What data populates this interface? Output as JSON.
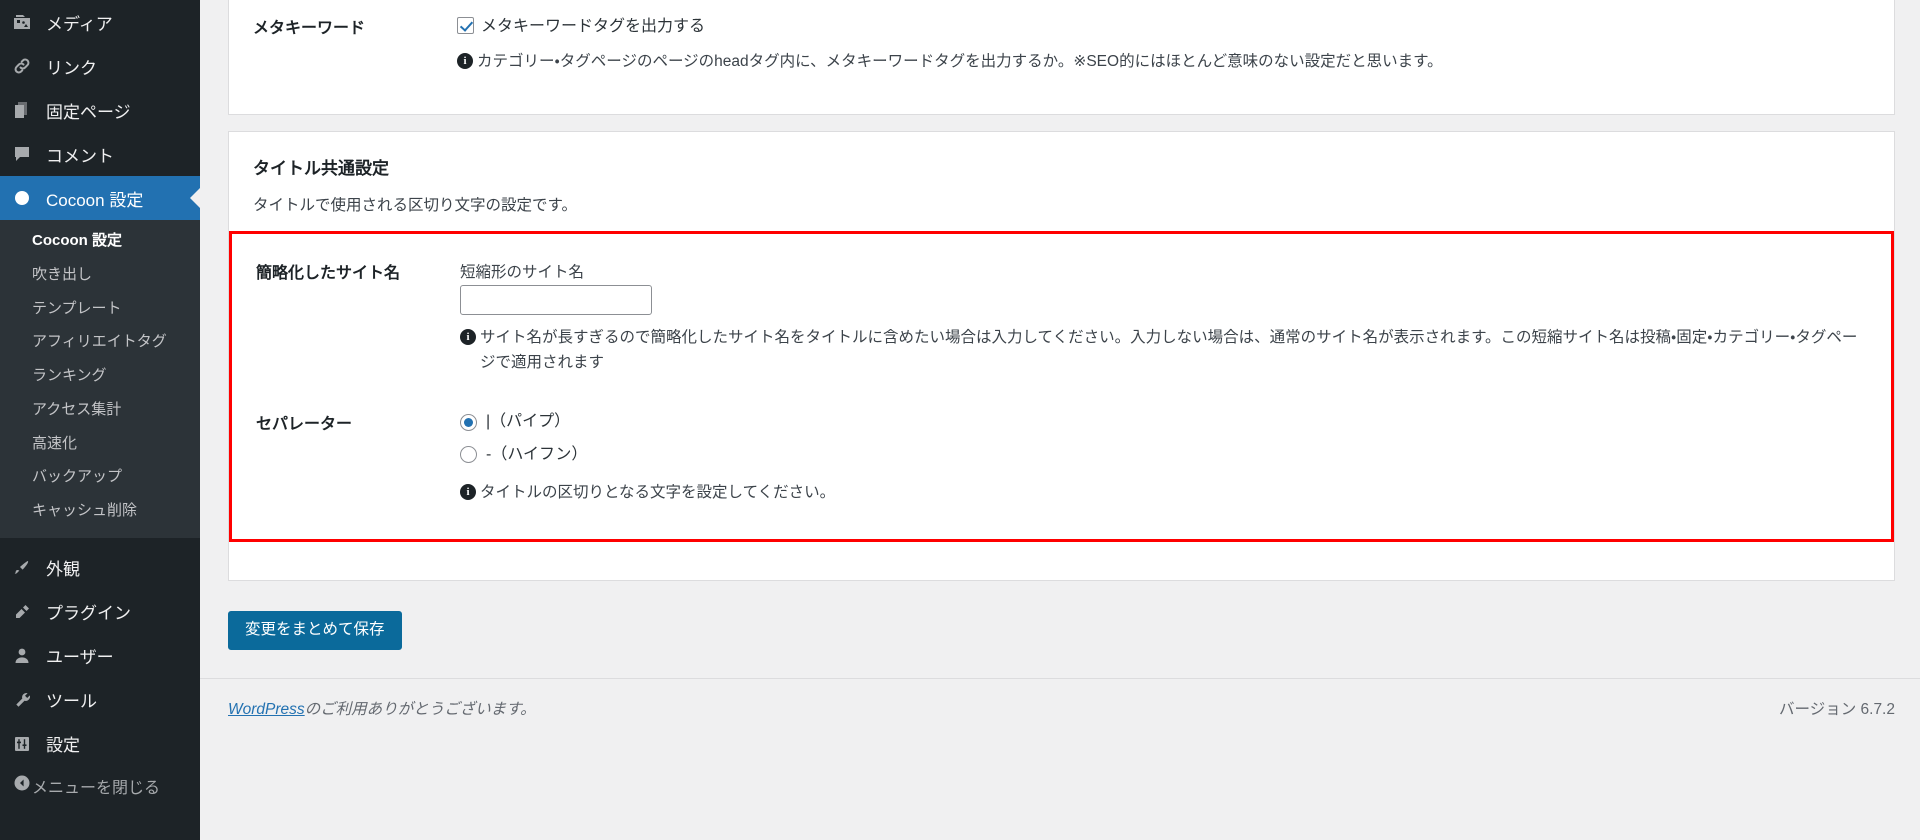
{
  "sidebar": {
    "items": [
      {
        "label": "メディア",
        "icon": "media-icon",
        "current": false
      },
      {
        "label": "リンク",
        "icon": "link-icon",
        "current": false
      },
      {
        "label": "固定ページ",
        "icon": "pages-icon",
        "current": false
      },
      {
        "label": "コメント",
        "icon": "comments-icon",
        "current": false
      },
      {
        "label": "Cocoon 設定",
        "icon": "cocoon-icon",
        "current": true
      }
    ],
    "submenu": [
      {
        "label": "Cocoon 設定",
        "current": true
      },
      {
        "label": "吹き出し",
        "current": false
      },
      {
        "label": "テンプレート",
        "current": false
      },
      {
        "label": "アフィリエイトタグ",
        "current": false
      },
      {
        "label": "ランキング",
        "current": false
      },
      {
        "label": "アクセス集計",
        "current": false
      },
      {
        "label": "高速化",
        "current": false
      },
      {
        "label": "バックアップ",
        "current": false
      },
      {
        "label": "キャッシュ削除",
        "current": false
      }
    ],
    "lower_items": [
      {
        "label": "外観",
        "icon": "appearance-icon"
      },
      {
        "label": "プラグイン",
        "icon": "plugins-icon"
      },
      {
        "label": "ユーザー",
        "icon": "users-icon"
      },
      {
        "label": "ツール",
        "icon": "tools-icon"
      },
      {
        "label": "設定",
        "icon": "settings-icon"
      }
    ],
    "collapse": {
      "label": "メニューを閉じる",
      "icon": "collapse-arrow-icon"
    }
  },
  "meta_keyword": {
    "row_label": "メタキーワード",
    "checkbox_label": "メタキーワードタグを出力する",
    "checkbox_checked": true,
    "description": "カテゴリー・タグページのページのheadタグ内に、メタキーワードタグを出力するか。※SEO的にはほとんど意味のない設定だと思います。"
  },
  "title_settings": {
    "panel_title": "タイトル共通設定",
    "panel_subtitle": "タイトルで使用される区切り文字の設定です。",
    "short_site_name": {
      "row_label": "簡略化したサイト名",
      "field_label": "短縮形のサイト名",
      "value": "",
      "placeholder": "",
      "description": "サイト名が長すぎるので簡略化したサイト名をタイトルに含めたい場合は入力してください。入力しない場合は、通常のサイト名が表示されます。この短縮サイト名は投稿・固定・カテゴリー・タグページで適用されます"
    },
    "separator": {
      "row_label": "セパレーター",
      "options": [
        {
          "label": "|（パイプ）",
          "selected": true
        },
        {
          "label": "-（ハイフン）",
          "selected": false
        }
      ],
      "description": "タイトルの区切りとなる文字を設定してください。"
    },
    "highlight_color": "#ff0000"
  },
  "actions": {
    "save_label": "変更をまとめて保存",
    "save_color": "#0b6a9b"
  },
  "footer": {
    "link_text": "WordPress",
    "thanks_text": "のご利用ありがとうございます。",
    "version_text": "バージョン 6.7.2"
  }
}
